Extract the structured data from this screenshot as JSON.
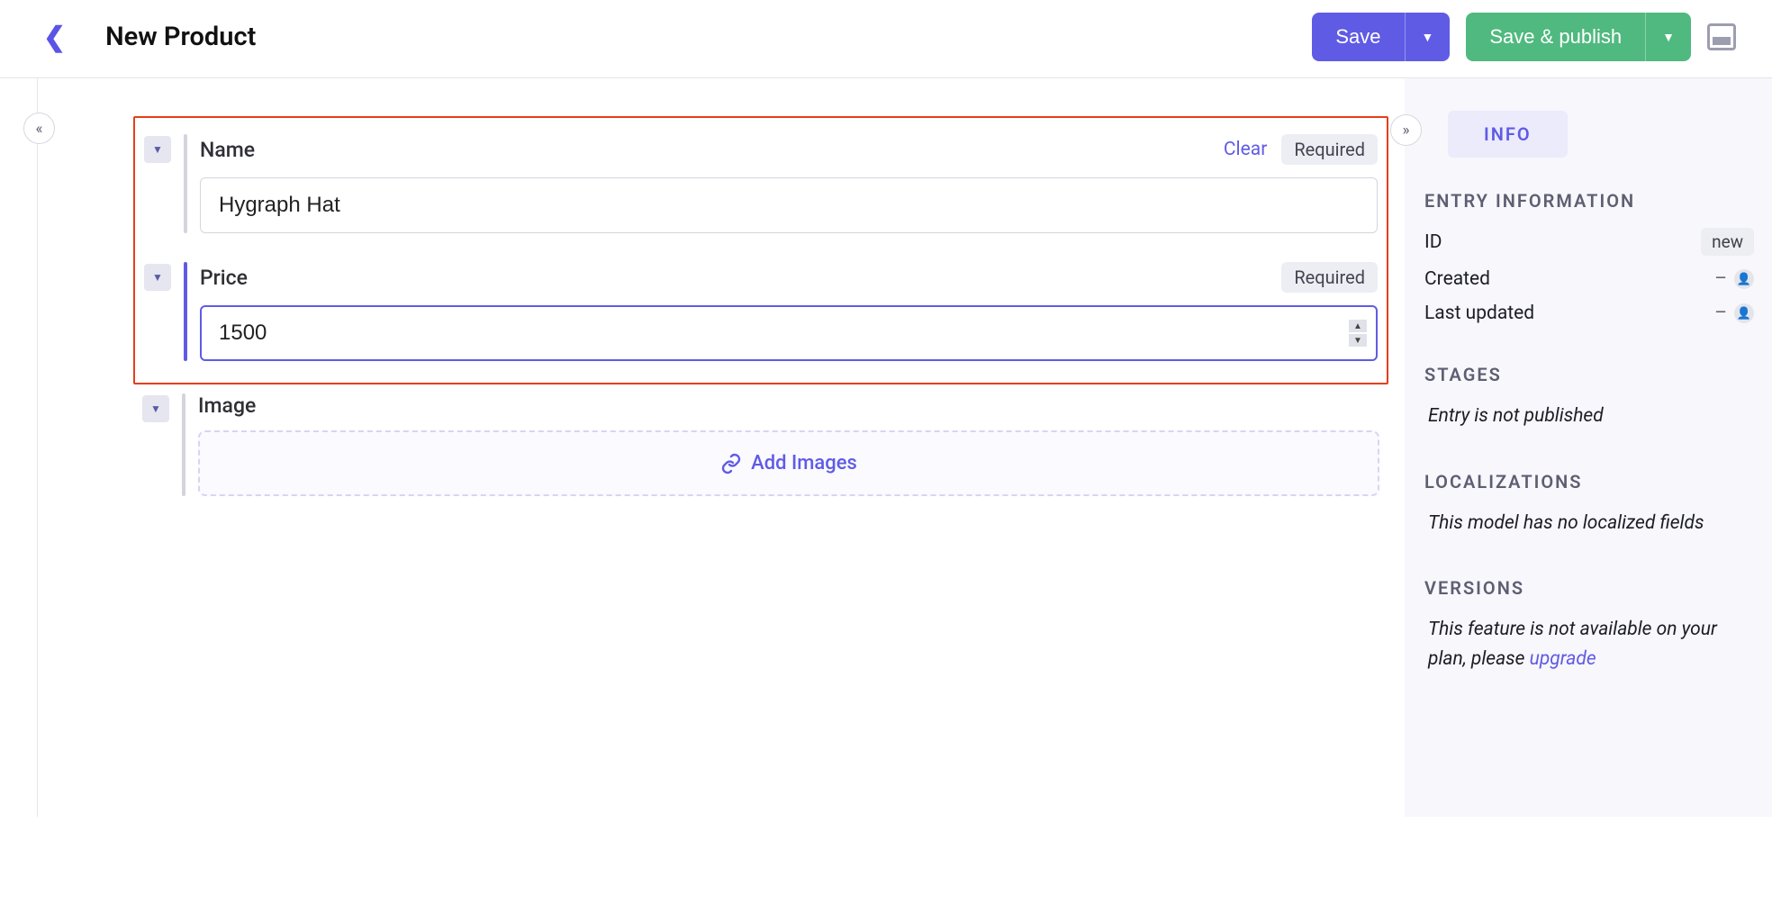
{
  "header": {
    "title": "New Product",
    "save_label": "Save",
    "save_publish_label": "Save & publish"
  },
  "fields": {
    "name": {
      "label": "Name",
      "value": "Hygraph Hat",
      "clear": "Clear",
      "required": "Required"
    },
    "price": {
      "label": "Price",
      "value": "1500",
      "required": "Required"
    },
    "image": {
      "label": "Image",
      "add_button": "Add Images"
    }
  },
  "sidebar": {
    "info_tab": "INFO",
    "entry_info": {
      "title": "ENTRY INFORMATION",
      "id_label": "ID",
      "id_value": "new",
      "created_label": "Created",
      "created_value": "–",
      "updated_label": "Last updated",
      "updated_value": "–"
    },
    "stages": {
      "title": "STAGES",
      "note": "Entry is not published"
    },
    "localizations": {
      "title": "LOCALIZATIONS",
      "note": "This model has no localized fields"
    },
    "versions": {
      "title": "VERSIONS",
      "note_prefix": "This feature is not available on your plan, please ",
      "upgrade": "upgrade"
    }
  }
}
